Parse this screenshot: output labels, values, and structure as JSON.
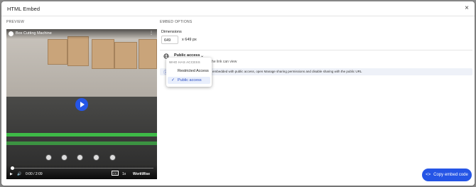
{
  "modal": {
    "title": "HTML Embed",
    "close_icon": "×"
  },
  "preview": {
    "label": "PREVIEW"
  },
  "video": {
    "title": "Box Cutting Machine",
    "more_icon": "⋮",
    "time": "0:00 / 2:09",
    "cc": "CC",
    "speed": "1x",
    "brand": "WorkWise",
    "play_icon": "▶",
    "volume_icon": "🔊"
  },
  "options": {
    "label": "EMBED OPTIONS",
    "dimensions_label": "Dimensions",
    "width_value": "649",
    "height_text": "x 649 px"
  },
  "access": {
    "globe_icon": "globe-icon",
    "button_label": "Public access",
    "chevron": "⌄",
    "desc_fragment": "ith the link can view",
    "info_icon": "ⓘ",
    "info_text": "embedded with public access, open Manage sharing permissions and disable sharing with the public URL"
  },
  "dropdown": {
    "header": "WHO HAS ACCESS",
    "items": [
      {
        "label": "Restricted Access",
        "selected": false
      },
      {
        "label": "Public access",
        "selected": true
      }
    ],
    "check_icon": "✓"
  },
  "footer": {
    "copy_label": "Copy embed code",
    "copy_icon": "<>"
  },
  "colors": {
    "accent": "#2555e6",
    "conveyor_green": "#3fd14a"
  }
}
